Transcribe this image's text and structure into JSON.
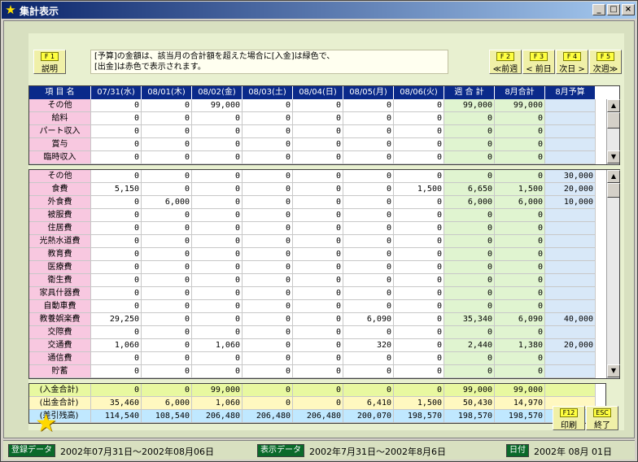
{
  "window": {
    "title": "集計表示"
  },
  "keys": {
    "f1": {
      "key": "F 1",
      "label": "説明"
    },
    "f2": {
      "key": "F 2",
      "label": "≪前週"
    },
    "f3": {
      "key": "F 3",
      "label": "< 前日"
    },
    "f4": {
      "key": "F 4",
      "label": "次日 >"
    },
    "f5": {
      "key": "F 5",
      "label": "次週≫"
    },
    "f12": {
      "key": "F12",
      "label": "印刷"
    },
    "esc": {
      "key": "ESC",
      "label": "終了"
    }
  },
  "message": "[予算]の金額は、該当月の合計額を超えた場合に[入金]は緑色で、\n[出金]は赤色で表示されます。",
  "headers": [
    "項 目 名",
    "07/31(水)",
    "08/01(木)",
    "08/02(金)",
    "08/03(土)",
    "08/04(日)",
    "08/05(月)",
    "08/06(火)",
    "週 合 計",
    "8月合計",
    "8月予算"
  ],
  "income": [
    {
      "name": "その他",
      "v": [
        "0",
        "0",
        "99,000",
        "0",
        "0",
        "0",
        "0",
        "99,000",
        "99,000",
        ""
      ]
    },
    {
      "name": "給料",
      "v": [
        "0",
        "0",
        "0",
        "0",
        "0",
        "0",
        "0",
        "0",
        "0",
        ""
      ]
    },
    {
      "name": "パート収入",
      "v": [
        "0",
        "0",
        "0",
        "0",
        "0",
        "0",
        "0",
        "0",
        "0",
        ""
      ]
    },
    {
      "name": "賞与",
      "v": [
        "0",
        "0",
        "0",
        "0",
        "0",
        "0",
        "0",
        "0",
        "0",
        ""
      ]
    },
    {
      "name": "臨時収入",
      "v": [
        "0",
        "0",
        "0",
        "0",
        "0",
        "0",
        "0",
        "0",
        "0",
        ""
      ]
    }
  ],
  "expense": [
    {
      "name": "その他",
      "v": [
        "0",
        "0",
        "0",
        "0",
        "0",
        "0",
        "0",
        "0",
        "0",
        "30,000"
      ]
    },
    {
      "name": "食費",
      "v": [
        "5,150",
        "0",
        "0",
        "0",
        "0",
        "0",
        "1,500",
        "6,650",
        "1,500",
        "20,000"
      ]
    },
    {
      "name": "外食費",
      "v": [
        "0",
        "6,000",
        "0",
        "0",
        "0",
        "0",
        "0",
        "6,000",
        "6,000",
        "10,000"
      ]
    },
    {
      "name": "被服費",
      "v": [
        "0",
        "0",
        "0",
        "0",
        "0",
        "0",
        "0",
        "0",
        "0",
        ""
      ]
    },
    {
      "name": "住居費",
      "v": [
        "0",
        "0",
        "0",
        "0",
        "0",
        "0",
        "0",
        "0",
        "0",
        ""
      ]
    },
    {
      "name": "光熱水道費",
      "v": [
        "0",
        "0",
        "0",
        "0",
        "0",
        "0",
        "0",
        "0",
        "0",
        ""
      ]
    },
    {
      "name": "教育費",
      "v": [
        "0",
        "0",
        "0",
        "0",
        "0",
        "0",
        "0",
        "0",
        "0",
        ""
      ]
    },
    {
      "name": "医療費",
      "v": [
        "0",
        "0",
        "0",
        "0",
        "0",
        "0",
        "0",
        "0",
        "0",
        ""
      ]
    },
    {
      "name": "衛生費",
      "v": [
        "0",
        "0",
        "0",
        "0",
        "0",
        "0",
        "0",
        "0",
        "0",
        ""
      ]
    },
    {
      "name": "家具什器費",
      "v": [
        "0",
        "0",
        "0",
        "0",
        "0",
        "0",
        "0",
        "0",
        "0",
        ""
      ]
    },
    {
      "name": "自動車費",
      "v": [
        "0",
        "0",
        "0",
        "0",
        "0",
        "0",
        "0",
        "0",
        "0",
        ""
      ]
    },
    {
      "name": "教養娯楽費",
      "v": [
        "29,250",
        "0",
        "0",
        "0",
        "0",
        "6,090",
        "0",
        "35,340",
        "6,090",
        "40,000"
      ]
    },
    {
      "name": "交際費",
      "v": [
        "0",
        "0",
        "0",
        "0",
        "0",
        "0",
        "0",
        "0",
        "0",
        ""
      ]
    },
    {
      "name": "交通費",
      "v": [
        "1,060",
        "0",
        "1,060",
        "0",
        "0",
        "320",
        "0",
        "2,440",
        "1,380",
        "20,000"
      ]
    },
    {
      "name": "通信費",
      "v": [
        "0",
        "0",
        "0",
        "0",
        "0",
        "0",
        "0",
        "0",
        "0",
        ""
      ]
    },
    {
      "name": "貯蓄",
      "v": [
        "0",
        "0",
        "0",
        "0",
        "0",
        "0",
        "0",
        "0",
        "0",
        ""
      ]
    }
  ],
  "summary": [
    {
      "name": "(入金合計)",
      "v": [
        "0",
        "0",
        "99,000",
        "0",
        "0",
        "0",
        "0",
        "99,000",
        "99,000",
        ""
      ]
    },
    {
      "name": "(出金合計)",
      "v": [
        "35,460",
        "6,000",
        "1,060",
        "0",
        "0",
        "6,410",
        "1,500",
        "50,430",
        "14,970",
        ""
      ]
    },
    {
      "name": "(差引残高)",
      "v": [
        "114,540",
        "108,540",
        "206,480",
        "206,480",
        "206,480",
        "200,070",
        "198,570",
        "198,570",
        "198,570",
        ""
      ]
    }
  ],
  "status": {
    "reg_label": "登録データ",
    "reg_value": "2002年07月31日～2002年08月06日",
    "disp_label": "表示データ",
    "disp_value": "2002年7月31日～2002年8月6日",
    "date_label": "日付",
    "date_value": "2002年 08月 01日"
  },
  "colors": {
    "header": "#0a2a8a",
    "label": "#f8c8e0",
    "titlebar": "#0a246a"
  }
}
